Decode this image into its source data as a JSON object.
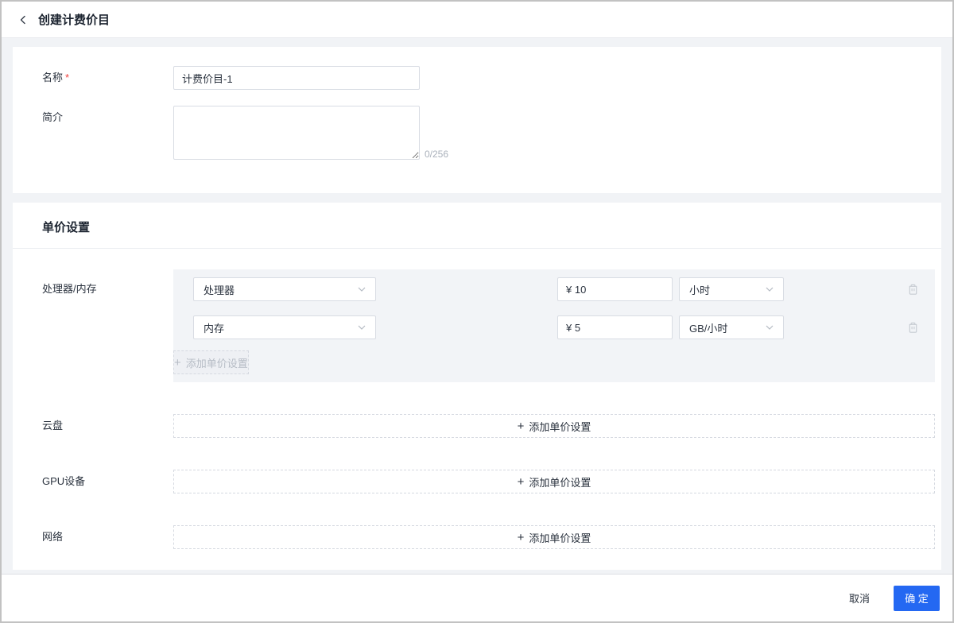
{
  "header": {
    "title": "创建计费价目"
  },
  "colors": {
    "primary_button": "#2468f2",
    "required_mark": "#f0413e",
    "panel_bg": "#f2f4f7",
    "page_bg": "#f1f3f6"
  },
  "form": {
    "name_label": "名称",
    "name_required_mark": "*",
    "name_value": "计费价目-1",
    "intro_label": "简介",
    "intro_value": "",
    "intro_counter": "0/256"
  },
  "pricing": {
    "title": "单价设置",
    "plus_glyph": "+",
    "groups": [
      {
        "label": "处理器/内存",
        "add_label": "添加单价设置",
        "rows": [
          {
            "type_value": "处理器",
            "price_value": "¥ 10",
            "unit_value": "小时"
          },
          {
            "type_value": "内存",
            "price_value": "¥ 5",
            "unit_value": "GB/小时"
          }
        ]
      },
      {
        "label": "云盘",
        "add_label": "添加单价设置"
      },
      {
        "label": "GPU设备",
        "add_label": "添加单价设置"
      },
      {
        "label": "网络",
        "add_label": "添加单价设置"
      }
    ]
  },
  "footer": {
    "cancel_label": "取消",
    "confirm_label": "确 定"
  }
}
